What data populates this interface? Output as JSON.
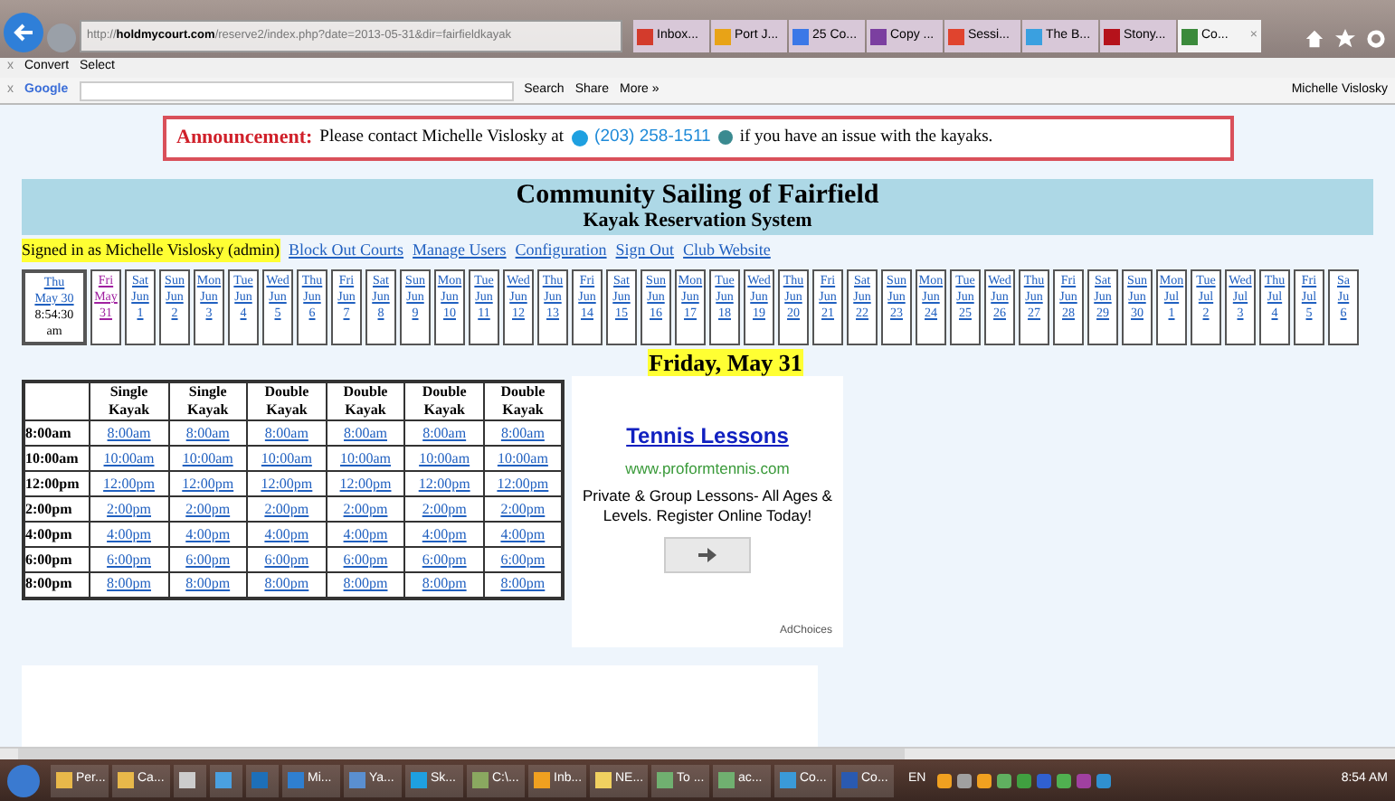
{
  "browser": {
    "url_prefix": "http://",
    "url_host": "holdmycourt.com",
    "url_path": "/reserve2/index.php?date=2013-05-31&dir=fairfieldkayak",
    "tabs": [
      {
        "label": "Inbox...",
        "color": "#d33b2c",
        "selected": false
      },
      {
        "label": "Port J...",
        "color": "#e8a317",
        "selected": false
      },
      {
        "label": "25 Co...",
        "color": "#3b78e7",
        "selected": false
      },
      {
        "label": "Copy ...",
        "color": "#7b3fa0",
        "selected": false
      },
      {
        "label": "Sessi...",
        "color": "#e0442e",
        "selected": false
      },
      {
        "label": "The B...",
        "color": "#3aa0e0",
        "selected": false
      },
      {
        "label": "Stony...",
        "color": "#b5121b",
        "selected": false
      },
      {
        "label": "Co...",
        "color": "#3b8a3b",
        "selected": true
      }
    ],
    "close_tab": "×"
  },
  "command_bar": {
    "close": "x",
    "items": [
      "Convert",
      "Select"
    ]
  },
  "google_bar": {
    "close": "x",
    "logo": "Google",
    "buttons": [
      "Search",
      "Share",
      "More »"
    ],
    "user": "Michelle Vislosky"
  },
  "announcement": {
    "label": "Announcement:",
    "text_before": "Please contact Michelle Vislosky at",
    "phone": "(203) 258-1511",
    "text_after": "if you have an issue with the kayaks."
  },
  "header": {
    "title": "Community Sailing of Fairfield",
    "subtitle": "Kayak Reservation System"
  },
  "nav": {
    "signed_in": "Signed in as Michelle Vislosky (admin)",
    "links": [
      "Block Out Courts",
      "Manage Users",
      "Configuration",
      "Sign Out",
      "Club Website"
    ]
  },
  "date_strip": {
    "today": {
      "day": "Thu",
      "date": "May 30",
      "time": "8:54:30",
      "ampm": "am"
    },
    "days": [
      {
        "day": "Fri",
        "month": "May",
        "date": "31",
        "selected": true
      },
      {
        "day": "Sat",
        "month": "Jun",
        "date": "1",
        "selected": false
      },
      {
        "day": "Sun",
        "month": "Jun",
        "date": "2",
        "selected": false
      },
      {
        "day": "Mon",
        "month": "Jun",
        "date": "3",
        "selected": false
      },
      {
        "day": "Tue",
        "month": "Jun",
        "date": "4",
        "selected": false
      },
      {
        "day": "Wed",
        "month": "Jun",
        "date": "5",
        "selected": false
      },
      {
        "day": "Thu",
        "month": "Jun",
        "date": "6",
        "selected": false
      },
      {
        "day": "Fri",
        "month": "Jun",
        "date": "7",
        "selected": false
      },
      {
        "day": "Sat",
        "month": "Jun",
        "date": "8",
        "selected": false
      },
      {
        "day": "Sun",
        "month": "Jun",
        "date": "9",
        "selected": false
      },
      {
        "day": "Mon",
        "month": "Jun",
        "date": "10",
        "selected": false
      },
      {
        "day": "Tue",
        "month": "Jun",
        "date": "11",
        "selected": false
      },
      {
        "day": "Wed",
        "month": "Jun",
        "date": "12",
        "selected": false
      },
      {
        "day": "Thu",
        "month": "Jun",
        "date": "13",
        "selected": false
      },
      {
        "day": "Fri",
        "month": "Jun",
        "date": "14",
        "selected": false
      },
      {
        "day": "Sat",
        "month": "Jun",
        "date": "15",
        "selected": false
      },
      {
        "day": "Sun",
        "month": "Jun",
        "date": "16",
        "selected": false
      },
      {
        "day": "Mon",
        "month": "Jun",
        "date": "17",
        "selected": false
      },
      {
        "day": "Tue",
        "month": "Jun",
        "date": "18",
        "selected": false
      },
      {
        "day": "Wed",
        "month": "Jun",
        "date": "19",
        "selected": false
      },
      {
        "day": "Thu",
        "month": "Jun",
        "date": "20",
        "selected": false
      },
      {
        "day": "Fri",
        "month": "Jun",
        "date": "21",
        "selected": false
      },
      {
        "day": "Sat",
        "month": "Jun",
        "date": "22",
        "selected": false
      },
      {
        "day": "Sun",
        "month": "Jun",
        "date": "23",
        "selected": false
      },
      {
        "day": "Mon",
        "month": "Jun",
        "date": "24",
        "selected": false
      },
      {
        "day": "Tue",
        "month": "Jun",
        "date": "25",
        "selected": false
      },
      {
        "day": "Wed",
        "month": "Jun",
        "date": "26",
        "selected": false
      },
      {
        "day": "Thu",
        "month": "Jun",
        "date": "27",
        "selected": false
      },
      {
        "day": "Fri",
        "month": "Jun",
        "date": "28",
        "selected": false
      },
      {
        "day": "Sat",
        "month": "Jun",
        "date": "29",
        "selected": false
      },
      {
        "day": "Sun",
        "month": "Jun",
        "date": "30",
        "selected": false
      },
      {
        "day": "Mon",
        "month": "Jul",
        "date": "1",
        "selected": false
      },
      {
        "day": "Tue",
        "month": "Jul",
        "date": "2",
        "selected": false
      },
      {
        "day": "Wed",
        "month": "Jul",
        "date": "3",
        "selected": false
      },
      {
        "day": "Thu",
        "month": "Jul",
        "date": "4",
        "selected": false
      },
      {
        "day": "Fri",
        "month": "Jul",
        "date": "5",
        "selected": false
      },
      {
        "day": "Sa",
        "month": "Ju",
        "date": "6",
        "selected": false
      }
    ]
  },
  "day_title": "Friday, May 31",
  "table": {
    "columns": [
      "Single Kayak",
      "Single Kayak",
      "Double Kayak",
      "Double Kayak",
      "Double Kayak",
      "Double Kayak"
    ],
    "rows": [
      {
        "time": "8:00am",
        "slots": [
          "8:00am",
          "8:00am",
          "8:00am",
          "8:00am",
          "8:00am",
          "8:00am"
        ]
      },
      {
        "time": "10:00am",
        "slots": [
          "10:00am",
          "10:00am",
          "10:00am",
          "10:00am",
          "10:00am",
          "10:00am"
        ]
      },
      {
        "time": "12:00pm",
        "slots": [
          "12:00pm",
          "12:00pm",
          "12:00pm",
          "12:00pm",
          "12:00pm",
          "12:00pm"
        ]
      },
      {
        "time": "2:00pm",
        "slots": [
          "2:00pm",
          "2:00pm",
          "2:00pm",
          "2:00pm",
          "2:00pm",
          "2:00pm"
        ]
      },
      {
        "time": "4:00pm",
        "slots": [
          "4:00pm",
          "4:00pm",
          "4:00pm",
          "4:00pm",
          "4:00pm",
          "4:00pm"
        ]
      },
      {
        "time": "6:00pm",
        "slots": [
          "6:00pm",
          "6:00pm",
          "6:00pm",
          "6:00pm",
          "6:00pm",
          "6:00pm"
        ]
      },
      {
        "time": "8:00pm",
        "slots": [
          "8:00pm",
          "8:00pm",
          "8:00pm",
          "8:00pm",
          "8:00pm",
          "8:00pm"
        ]
      }
    ]
  },
  "ad": {
    "title": "Tennis Lessons",
    "url": "www.proformtennis.com",
    "text": "Private & Group Lessons- All Ages & Levels. Register Online Today!",
    "choices": "AdChoices"
  },
  "taskbar": {
    "items": [
      {
        "label": "Per...",
        "color": "#e8b84a"
      },
      {
        "label": "Ca...",
        "color": "#e8b84a"
      },
      {
        "color": "#cccccc"
      },
      {
        "color": "#4aa0e0"
      },
      {
        "color": "#1d6fb8"
      },
      {
        "label": "Mi...",
        "color": "#2f7fd0"
      },
      {
        "label": "Ya...",
        "color": "#5a8fd0"
      },
      {
        "label": "Sk...",
        "color": "#1ea0e0"
      },
      {
        "label": "C:\\...",
        "color": "#8aa860"
      },
      {
        "label": "Inb...",
        "color": "#f0a020"
      },
      {
        "label": "NE...",
        "color": "#f0d060"
      },
      {
        "label": "To ...",
        "color": "#70b070"
      },
      {
        "label": "ac...",
        "color": "#70b070"
      },
      {
        "label": "Co...",
        "color": "#3a9ad8"
      },
      {
        "label": "Co...",
        "color": "#2a5ab0"
      }
    ],
    "language": "EN",
    "clock": "8:54 AM"
  }
}
